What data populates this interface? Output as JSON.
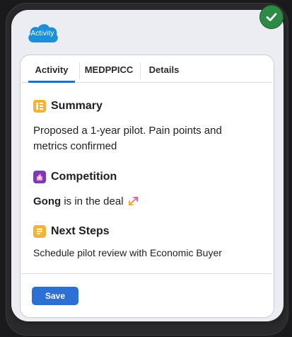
{
  "brand": {
    "label": "Activity",
    "color": "#1b8fd9"
  },
  "status": {
    "icon": "check-icon",
    "color": "#2e8b46"
  },
  "tabs": [
    {
      "label": "Activity",
      "active": true
    },
    {
      "label": "MEDPPICC",
      "active": false
    },
    {
      "label": "Details",
      "active": false
    }
  ],
  "summary": {
    "icon": "summary-icon",
    "title": "Summary",
    "text_line1": "Proposed a 1-year pilot. Pain points and",
    "text_line2": "metrics confirmed"
  },
  "competition": {
    "icon": "competition-icon",
    "title": "Competition",
    "competitor": "Gong",
    "text": " is in the deal"
  },
  "next_steps": {
    "icon": "notes-icon",
    "title": "Next Steps",
    "text": "Schedule pilot review with Economic Buyer"
  },
  "actions": {
    "save_label": "Save"
  },
  "colors": {
    "accent": "#1d6fd1",
    "button": "#2c6fd6",
    "summary_icon": "#f2b33a",
    "competition_icon": "#7a3bb5",
    "notes_icon": "#f2b33a"
  }
}
